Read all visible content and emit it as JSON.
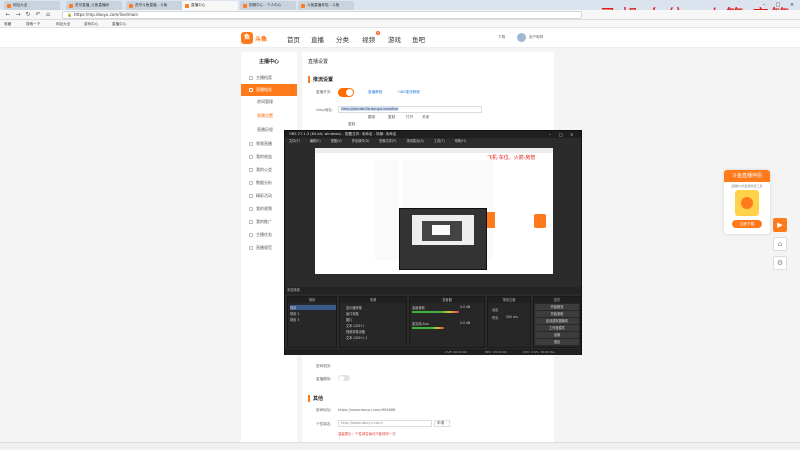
{
  "browser": {
    "tabs": [
      {
        "label": "网址大全",
        "active": false
      },
      {
        "label": "虎牙直播_斗鱼直播间",
        "active": false
      },
      {
        "label": "虎牙斗鱼直播 - 斗鱼",
        "active": false
      },
      {
        "label": "直播中心",
        "active": true
      },
      {
        "label": "视频中心 - 个人中心",
        "active": false
      },
      {
        "label": "斗鱼直播伴侣 - 斗鱼",
        "active": false
      }
    ],
    "url": "https://mp.douyu.com/live/main",
    "bookmarks": [
      "收藏",
      "搜索一下",
      "网址大全",
      "游戏中心",
      "直播中心"
    ]
  },
  "overlay_text": "飞机-车位、火箭-房管",
  "site": {
    "logo_text": "斗鱼",
    "nav": [
      "首页",
      "直播",
      "分类",
      "视频",
      "游戏",
      "鱼吧"
    ],
    "nav_badge": "5",
    "header_right": [
      "下载",
      "用户昵称"
    ]
  },
  "sidebar": {
    "title": "主播中心",
    "items": [
      {
        "label": "主播档案",
        "type": "item"
      },
      {
        "label": "直播相关",
        "type": "active"
      },
      {
        "label": "房间管理",
        "type": "sub"
      },
      {
        "label": "直播设置",
        "type": "sub-sel"
      },
      {
        "label": "直播历程",
        "type": "sub"
      },
      {
        "label": "视频直播",
        "type": "item"
      },
      {
        "label": "我的收益",
        "type": "item"
      },
      {
        "label": "我的公会",
        "type": "item"
      },
      {
        "label": "数据分析",
        "type": "item"
      },
      {
        "label": "精彩活动",
        "type": "item"
      },
      {
        "label": "我的视频",
        "type": "item"
      },
      {
        "label": "我的推广",
        "type": "item"
      },
      {
        "label": "主播任务",
        "type": "item"
      },
      {
        "label": "直播规范",
        "type": "item"
      }
    ]
  },
  "main": {
    "title": "直播设置",
    "section1": "推流设置",
    "stream_switch_label": "直播开关:",
    "link_tutorial": "直播教程",
    "link_obs": "OBS推流教程",
    "rtmp_label": "rtmp地址:",
    "rtmp_value": "rtmp://sendtc3a.douyu.com/live",
    "btn_flip": "翻录",
    "btn_copy": "复制",
    "btn_on": "打开",
    "btn_close": "关闭",
    "copy2": "复制",
    "private_label": "密码相关:",
    "auto_label": "直播模拟:",
    "section2": "其他",
    "room_label": "房间地址:",
    "room_value": "https://www.douyu.com/905888",
    "domain_label": "个性域名:",
    "domain_value": "http://www.douyu.com/",
    "domain_btn": "申请",
    "domain_note": "温馨提示：个性域名每月只能修改一次"
  },
  "rank": {
    "head": "斗鱼直播伴侣",
    "sub": "超越PC的直播伴侣工具",
    "btn": "立即下载"
  },
  "obs": {
    "title": "OBS 27.1.3 (64-bit, windows) - 配置文件: 未命名 - 场景: 未命名",
    "menu": [
      "文件(F)",
      "编辑(E)",
      "视图(V)",
      "停靠部件(D)",
      "配置文件(P)",
      "场景集合(S)",
      "工具(T)",
      "帮助(H)"
    ],
    "preview_text": "飞机-车位、火箭-房管",
    "scene_bar": "未选择源",
    "scenes_head": "场景",
    "scenes": [
      "场景",
      "场景 2",
      "场景 3"
    ],
    "sources_head": "来源",
    "sources": [
      "显示器采集",
      "窗口采集",
      "图片",
      "文本 (GDI+)",
      "视频采集设备",
      "文本 (GDI+) 2"
    ],
    "mixer_head": "混音器",
    "mixer": [
      {
        "name": "桌面音频",
        "db": "0.0 dB",
        "level": 0.65
      },
      {
        "name": "麦克风/Aux",
        "db": "0.0 dB",
        "level": 0.45
      }
    ],
    "transitions_head": "场景过渡",
    "transition": "淡出",
    "duration_label": "时长",
    "duration_value": "300 ms",
    "controls_head": "控件",
    "controls": [
      "开始推流",
      "开始录制",
      "启动虚拟摄像机",
      "工作室模式",
      "设置",
      "退出"
    ],
    "status": [
      "LIVE: 00:00:00",
      "REC: 00:00:00",
      "CPU: 2.6%, 30.00 fps"
    ]
  }
}
